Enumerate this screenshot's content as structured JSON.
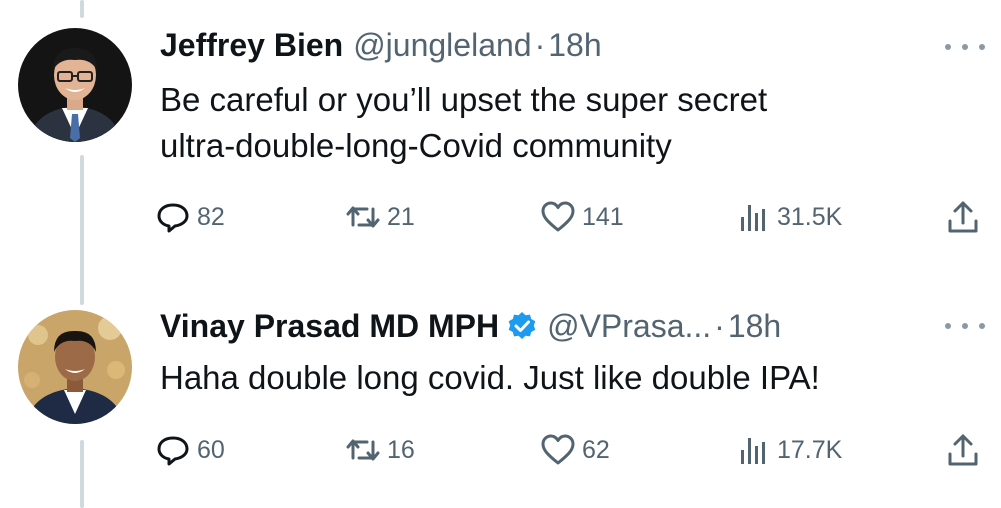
{
  "tweets": [
    {
      "display_name": "Jeffrey Bien",
      "handle": "@jungleland",
      "separator": "·",
      "time": "18h",
      "verified": false,
      "text_lines": [
        "Be careful or you’ll upset the super secret",
        "ultra-double-long-Covid community"
      ],
      "replies": "82",
      "retweets": "21",
      "likes": "141",
      "views": "31.5K"
    },
    {
      "display_name": "Vinay Prasad MD MPH",
      "handle": "@VPrasa...",
      "separator": "·",
      "time": "18h",
      "verified": true,
      "text_lines": [
        "Haha double long covid. Just like double IPA!"
      ],
      "replies": "60",
      "retweets": "16",
      "likes": "62",
      "views": "17.7K"
    }
  ],
  "icons": {
    "reply": "reply-icon",
    "retweet": "retweet-icon",
    "like": "heart-icon",
    "views": "views-icon",
    "share": "share-icon",
    "more": "more-icon",
    "verified": "verified-badge-icon"
  },
  "colors": {
    "text": "#0f1419",
    "secondary": "#536471",
    "thread_line": "#cfd9de",
    "verified_blue": "#1d9bf0"
  }
}
